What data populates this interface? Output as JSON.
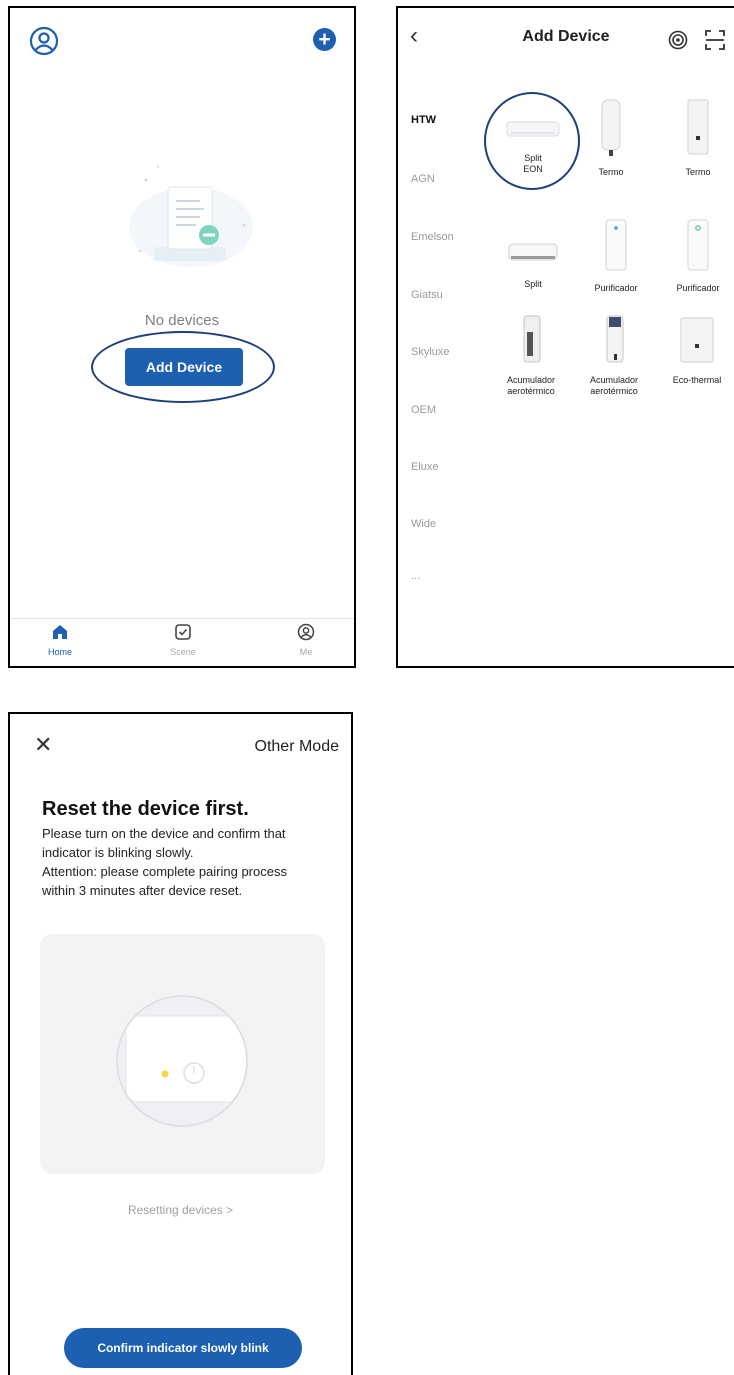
{
  "home": {
    "empty_text": "No devices",
    "add_device_label": "Add Device",
    "tabs": [
      {
        "label": "Home",
        "icon": "home-icon",
        "active": true
      },
      {
        "label": "Scene",
        "icon": "checkbox-icon",
        "active": false
      },
      {
        "label": "Me",
        "icon": "user-circle-icon",
        "active": false
      }
    ]
  },
  "add_device": {
    "title": "Add Device",
    "brands": [
      "HTW",
      "AGN",
      "Emelson",
      "Giatsu",
      "Skyluxe",
      "OEM",
      "Eluxe",
      "Wide",
      "..."
    ],
    "selected_brand": "HTW",
    "devices": [
      {
        "label": "Split\nEON",
        "icon": "split-ac-icon"
      },
      {
        "label": "Termo",
        "icon": "water-heater-icon"
      },
      {
        "label": "Termo",
        "icon": "water-heater-flat-icon"
      },
      {
        "label": "Split",
        "icon": "split-ac-icon"
      },
      {
        "label": "Purificador",
        "icon": "air-purifier-icon"
      },
      {
        "label": "Purificador",
        "icon": "air-purifier-icon"
      },
      {
        "label": "Acumulador\naerotérmico",
        "icon": "heat-pump-icon"
      },
      {
        "label": "Acumulador\naerotérmico",
        "icon": "heat-pump-icon"
      },
      {
        "label": "Eco-thermal",
        "icon": "boiler-icon"
      }
    ]
  },
  "reset": {
    "other_mode": "Other Mode",
    "title": "Reset the device first.",
    "desc_lines": [
      "Please turn on the device and confirm that",
      "indicator is blinking slowly.",
      "Attention: please complete pairing process",
      "within 3 minutes after device reset."
    ],
    "resetting_link": "Resetting devices >",
    "confirm_label": "Confirm indicator slowly blink"
  },
  "colors": {
    "accent": "#1d5fb1",
    "highlight_ring": "#1c3f7c",
    "indicator": "#f5d94a"
  }
}
